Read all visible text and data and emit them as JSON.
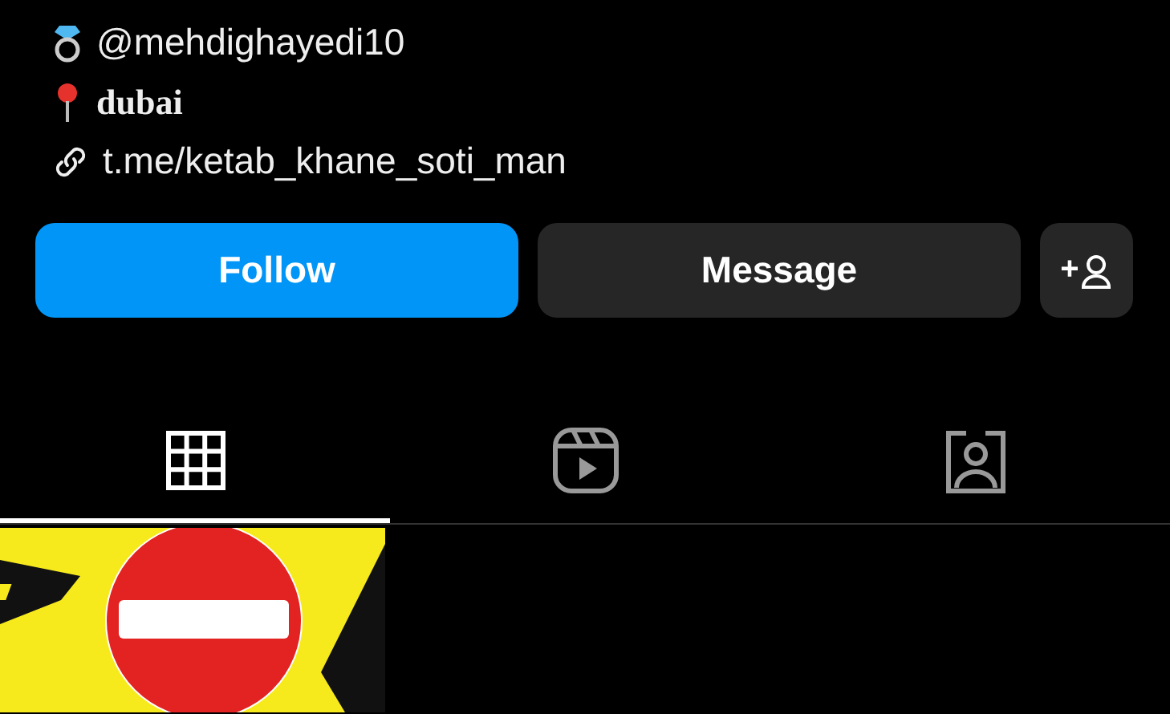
{
  "bio": [
    {
      "kind": "ring",
      "text": "@mehdighayedi10",
      "bold": false
    },
    {
      "kind": "pin",
      "text": "dubai",
      "bold": true
    },
    {
      "kind": "link",
      "text": "t.me/ketab_khane_soti_man",
      "bold": false
    }
  ],
  "buttons": [
    {
      "kind": "primary",
      "label": "Follow"
    },
    {
      "kind": "secondary",
      "label": "Message"
    },
    {
      "kind": "add-person",
      "label": "+"
    }
  ],
  "tabs": [
    {
      "kind": "grid",
      "selected": true
    },
    {
      "kind": "reels",
      "selected": false
    },
    {
      "kind": "tagged",
      "selected": false
    }
  ],
  "posts": [
    {
      "kind": "no-entry-sign"
    }
  ]
}
